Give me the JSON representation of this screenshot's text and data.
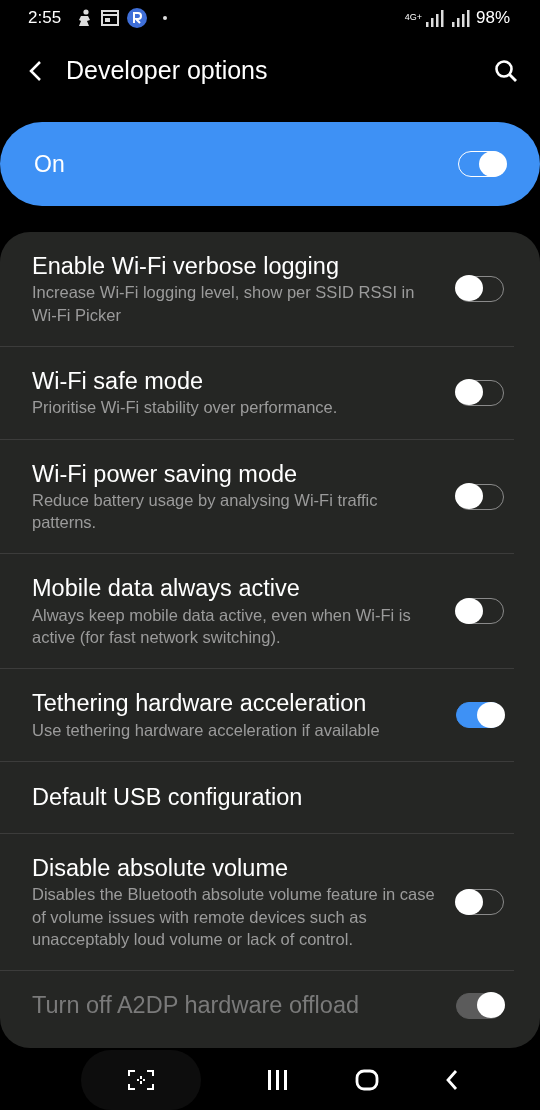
{
  "status_bar": {
    "time": "2:55",
    "network": "4G+",
    "battery": "98%"
  },
  "header": {
    "title": "Developer options"
  },
  "master": {
    "label": "On",
    "on": true
  },
  "items": [
    {
      "kind": "toggle",
      "title": "Enable Wi-Fi verbose logging",
      "subtitle": "Increase Wi-Fi logging level, show per SSID RSSI in Wi-Fi Picker",
      "checked": false,
      "disabled": false
    },
    {
      "kind": "toggle",
      "title": "Wi-Fi safe mode",
      "subtitle": "Prioritise Wi-Fi stability over performance.",
      "checked": false,
      "disabled": false
    },
    {
      "kind": "toggle",
      "title": "Wi-Fi power saving mode",
      "subtitle": "Reduce battery usage by analysing Wi-Fi traffic patterns.",
      "checked": false,
      "disabled": false
    },
    {
      "kind": "toggle",
      "title": "Mobile data always active",
      "subtitle": "Always keep mobile data active, even when Wi-Fi is active (for fast network switching).",
      "checked": false,
      "disabled": false
    },
    {
      "kind": "toggle",
      "title": "Tethering hardware acceleration",
      "subtitle": "Use tethering hardware acceleration if available",
      "checked": true,
      "disabled": false
    },
    {
      "kind": "link",
      "title": "Default USB configuration"
    },
    {
      "kind": "toggle",
      "title": "Disable absolute volume",
      "subtitle": "Disables the Bluetooth absolute volume feature in case of volume issues with remote devices such as unacceptably loud volume or lack of control.",
      "checked": false,
      "disabled": false
    },
    {
      "kind": "toggle",
      "title": "Turn off A2DP hardware offload",
      "checked": true,
      "disabled": true
    }
  ]
}
